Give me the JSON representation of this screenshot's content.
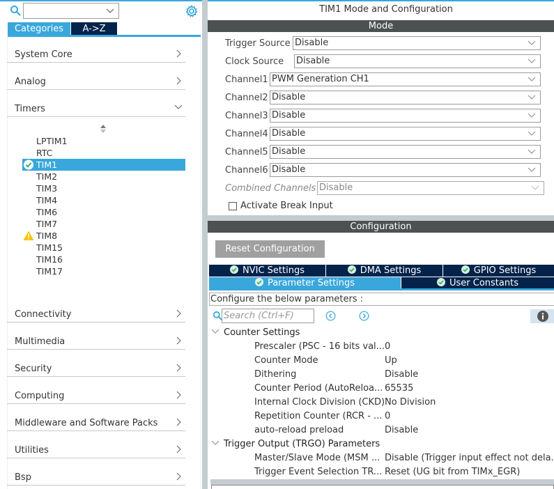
{
  "left_panel": {
    "search": {
      "value": "",
      "placeholder": ""
    },
    "tabs": [
      {
        "label": "Categories",
        "active": true
      },
      {
        "label": "A->Z",
        "active": false
      }
    ],
    "categories_top": [
      {
        "label": "System Core",
        "expanded": false
      },
      {
        "label": "Analog",
        "expanded": false
      },
      {
        "label": "Timers",
        "expanded": true
      }
    ],
    "timers": [
      {
        "label": "LPTIM1",
        "status": "none"
      },
      {
        "label": "RTC",
        "status": "none"
      },
      {
        "label": "TIM1",
        "status": "ok",
        "selected": true
      },
      {
        "label": "TIM2",
        "status": "none"
      },
      {
        "label": "TIM3",
        "status": "none"
      },
      {
        "label": "TIM4",
        "status": "none"
      },
      {
        "label": "TIM6",
        "status": "none"
      },
      {
        "label": "TIM7",
        "status": "none"
      },
      {
        "label": "TIM8",
        "status": "warning"
      },
      {
        "label": "TIM15",
        "status": "none"
      },
      {
        "label": "TIM16",
        "status": "none"
      },
      {
        "label": "TIM17",
        "status": "none"
      }
    ],
    "categories_bottom": [
      {
        "label": "Connectivity"
      },
      {
        "label": "Multimedia"
      },
      {
        "label": "Security"
      },
      {
        "label": "Computing"
      },
      {
        "label": "Middleware and Software Packs"
      },
      {
        "label": "Utilities"
      },
      {
        "label": "Bsp"
      }
    ]
  },
  "right_panel": {
    "title": "TIM1 Mode and Configuration",
    "mode_header": "Mode",
    "mode_fields": [
      {
        "label": "Trigger Source",
        "value": "Disable",
        "disabled": false
      },
      {
        "label": "Clock Source",
        "value": "Disable",
        "disabled": false
      },
      {
        "label": "Channel1",
        "value": "PWM Generation CH1",
        "disabled": false
      },
      {
        "label": "Channel2",
        "value": "Disable",
        "disabled": false
      },
      {
        "label": "Channel3",
        "value": "Disable",
        "disabled": false
      },
      {
        "label": "Channel4",
        "value": "Disable",
        "disabled": false
      },
      {
        "label": "Channel5",
        "value": "Disable",
        "disabled": false
      },
      {
        "label": "Channel6",
        "value": "Disable",
        "disabled": false
      },
      {
        "label": "Combined Channels",
        "value": "Disable",
        "disabled": true
      }
    ],
    "break_input": {
      "label": "Activate Break Input",
      "checked": false
    },
    "config_header": "Configuration",
    "reset_button": "Reset Configuration",
    "config_tabs_row1": [
      {
        "label": "NVIC Settings",
        "active": false
      },
      {
        "label": "DMA Settings",
        "active": false
      },
      {
        "label": "GPIO Settings",
        "active": false
      }
    ],
    "config_tabs_row2": [
      {
        "label": "Parameter Settings",
        "active": true
      },
      {
        "label": "User Constants",
        "active": false
      }
    ],
    "hint": "Configure the below parameters :",
    "param_search": {
      "value": "",
      "placeholder": "Search (Ctrl+F)"
    },
    "groups": [
      {
        "label": "Counter Settings",
        "params": [
          {
            "name": "Prescaler (PSC - 16 bits val...",
            "value": "0"
          },
          {
            "name": "Counter Mode",
            "value": "Up"
          },
          {
            "name": "Dithering",
            "value": "Disable"
          },
          {
            "name": "Counter Period (AutoReloa...",
            "value": "65535"
          },
          {
            "name": "Internal Clock Division (CKD)",
            "value": "No Division"
          },
          {
            "name": "Repetition Counter (RCR - ...",
            "value": "0"
          },
          {
            "name": "auto-reload preload",
            "value": "Disable"
          }
        ]
      },
      {
        "label": "Trigger Output (TRGO) Parameters",
        "params": [
          {
            "name": "Master/Slave Mode (MSM ...",
            "value": "Disable (Trigger input effect not dela..."
          },
          {
            "name": "Trigger Event Selection TR...",
            "value": "Reset (UG bit from TIMx_EGR)"
          }
        ]
      }
    ]
  },
  "colors": {
    "accent": "#39a7db",
    "navy": "#03234b",
    "header_bar": "#4d5152",
    "ok_green": "#3cb371",
    "warning_yellow": "#f5c400"
  }
}
